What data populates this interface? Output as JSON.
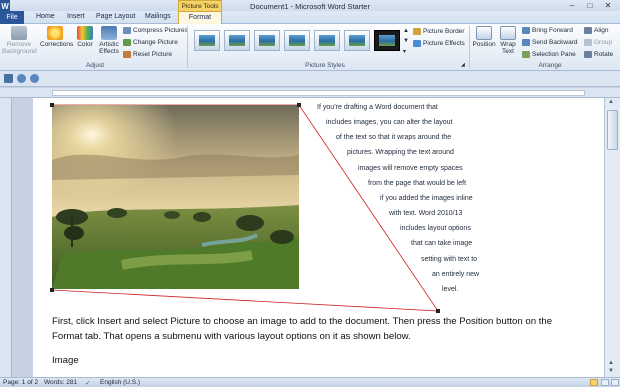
{
  "window": {
    "title": "Document1 - Microsoft Word Starter",
    "logo": "W",
    "minimize": "–",
    "maximize": "□",
    "close": "✕"
  },
  "tabs": {
    "file": "File",
    "home": "Home",
    "insert": "Insert",
    "page_layout": "Page Layout",
    "mailings": "Mailings",
    "contextual_header": "Picture Tools",
    "format": "Format"
  },
  "ribbon": {
    "adjust": {
      "label": "Adjust",
      "remove_background": "Remove Background",
      "corrections": "Corrections",
      "color": "Color",
      "artistic_effects": "Artistic Effects",
      "compress": "Compress Pictures",
      "change": "Change Picture",
      "reset": "Reset Picture"
    },
    "picture_styles": {
      "label": "Picture Styles",
      "border": "Picture Border",
      "effects": "Picture Effects"
    },
    "arrange": {
      "label": "Arrange",
      "position": "Position",
      "wrap_text": "Wrap Text",
      "bring_forward": "Bring Forward",
      "send_backward": "Send Backward",
      "selection_pane": "Selection Pane",
      "align": "Align",
      "group": "Group",
      "rotate": "Rotate"
    }
  },
  "document": {
    "wrap_lines": [
      "If you’re drafting a Word document that",
      "includes images, you can alter the layout",
      "of the text so that it wraps around the",
      "pictures. Wrapping the text around",
      "images will remove empty spaces",
      "from the page that would be left",
      "if you added the images inline",
      "with text. Word 2010/13",
      "includes layout options",
      "that can take image",
      "setting with text to",
      "an entirely new",
      "level."
    ],
    "paragraph1": "First, click Insert and select Picture to choose an image to add to the document. Then press the Position button on the Format tab. That opens a submenu with various layout options on it as shown below.",
    "paragraph2": "Image"
  },
  "status": {
    "page": "Page: 1 of 2",
    "words": "Words: 281",
    "language": "English (U.S.)"
  },
  "colors": {
    "file_tab": "#2b579a",
    "contextual_tab": "#f4d46a",
    "wrap_boundary": "#d02020"
  }
}
